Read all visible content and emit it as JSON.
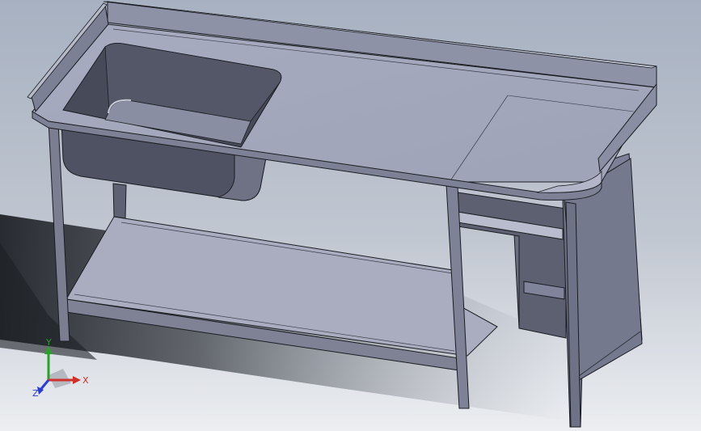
{
  "viewport": {
    "background_top": "#a9b4c4",
    "background_bottom": "#e8eaee"
  },
  "model": {
    "name": "sink-table",
    "parts": [
      "backsplash",
      "worktop",
      "sink-bowl",
      "drainboard",
      "undershelf",
      "side-cabinet",
      "legs"
    ]
  },
  "triad": {
    "x_label": "X",
    "y_label": "Y",
    "z_label": "Z",
    "x_color": "#d0302a",
    "y_color": "#2aa02a",
    "z_color": "#2a3cd0"
  }
}
